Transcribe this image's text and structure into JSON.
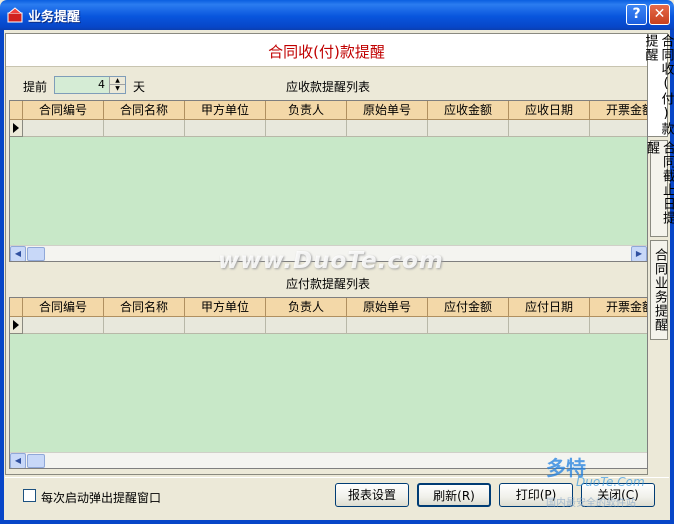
{
  "window": {
    "title": "业务提醒",
    "help_glyph": "?",
    "close_glyph": "✕"
  },
  "header": {
    "title": "合同收(付)款提醒"
  },
  "controls": {
    "advance_label": "提前",
    "days_value": "4",
    "days_unit": "天"
  },
  "receivable": {
    "list_label": "应收款提醒列表",
    "columns": [
      "合同编号",
      "合同名称",
      "甲方单位",
      "负责人",
      "原始单号",
      "应收金额",
      "应收日期",
      "开票金额"
    ]
  },
  "payable": {
    "list_label": "应付款提醒列表",
    "columns": [
      "合同编号",
      "合同名称",
      "甲方单位",
      "负责人",
      "原始单号",
      "应付金额",
      "应付日期",
      "开票金额"
    ]
  },
  "side_tabs": [
    "合同收(付)款提醒",
    "合同截止日提醒",
    "合同业务提醒"
  ],
  "footer": {
    "checkbox_label": "每次启动弹出提醒窗口",
    "buttons": {
      "report": "报表设置",
      "refresh": "刷新(R)",
      "print": "打印(P)",
      "close": "关闭(C)"
    }
  },
  "watermark": {
    "text": "www.DuoTe.com",
    "corner_logo": "多特",
    "corner_site": "DuoTe.Com",
    "corner_sub": "国内最安全的软件站"
  },
  "colors": {
    "title": "#c00000",
    "grid_bg": "#c8e8c8",
    "header_bg": "#f3d8a8"
  }
}
